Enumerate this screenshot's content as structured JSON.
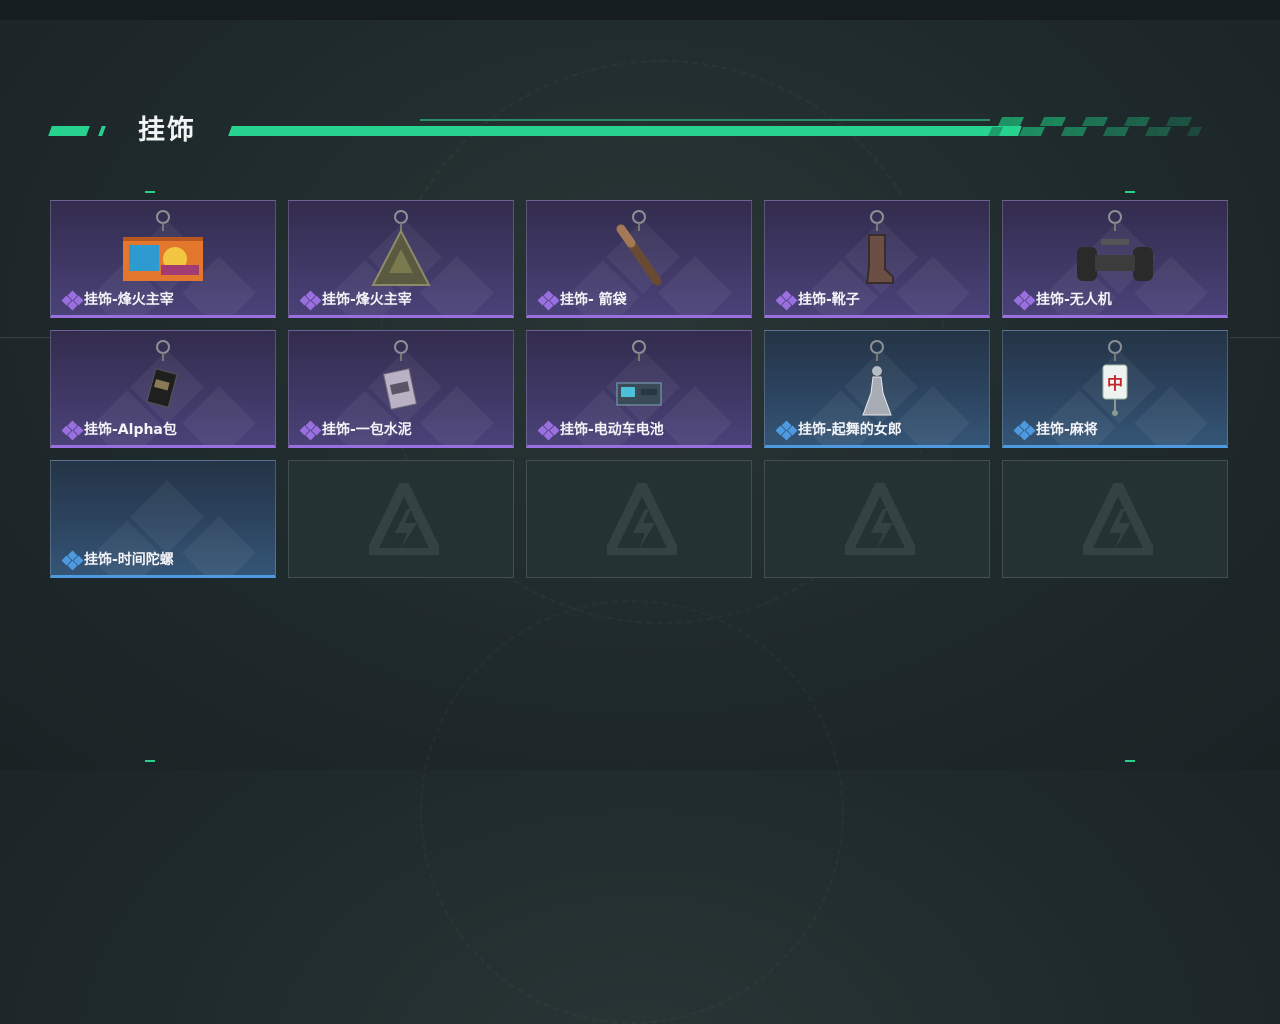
{
  "section": {
    "title": "挂饰"
  },
  "items": [
    {
      "label": "挂饰-烽火主宰",
      "rarity": "purple",
      "icon": "graffiti-container-charm"
    },
    {
      "label": "挂饰-烽火主宰",
      "rarity": "purple",
      "icon": "triangle-pyramid-charm"
    },
    {
      "label": "挂饰- 箭袋",
      "rarity": "purple",
      "icon": "quiver-charm"
    },
    {
      "label": "挂饰-靴子",
      "rarity": "purple",
      "icon": "boot-charm"
    },
    {
      "label": "挂饰-无人机",
      "rarity": "purple",
      "icon": "drone-wheels-charm"
    },
    {
      "label": "挂饰-Alpha包",
      "rarity": "purple",
      "icon": "alpha-pack-charm"
    },
    {
      "label": "挂饰-一包水泥",
      "rarity": "purple",
      "icon": "cement-bag-charm"
    },
    {
      "label": "挂饰-电动车电池",
      "rarity": "purple",
      "icon": "ebike-battery-charm"
    },
    {
      "label": "挂饰-起舞的女郎",
      "rarity": "blue",
      "icon": "dancing-lady-charm"
    },
    {
      "label": "挂饰-麻将",
      "rarity": "blue",
      "icon": "mahjong-tile-charm",
      "tile_glyph": "中"
    },
    {
      "label": "挂饰-时间陀螺",
      "rarity": "blue",
      "icon": "empty"
    },
    {
      "label": "",
      "rarity": "empty",
      "icon": "placeholder-logo"
    },
    {
      "label": "",
      "rarity": "empty",
      "icon": "placeholder-logo"
    },
    {
      "label": "",
      "rarity": "empty",
      "icon": "placeholder-logo"
    },
    {
      "label": "",
      "rarity": "empty",
      "icon": "placeholder-logo"
    }
  ],
  "colors": {
    "accent": "#27d38e",
    "purple": "#9a6fe0",
    "blue": "#4e9ae0"
  }
}
